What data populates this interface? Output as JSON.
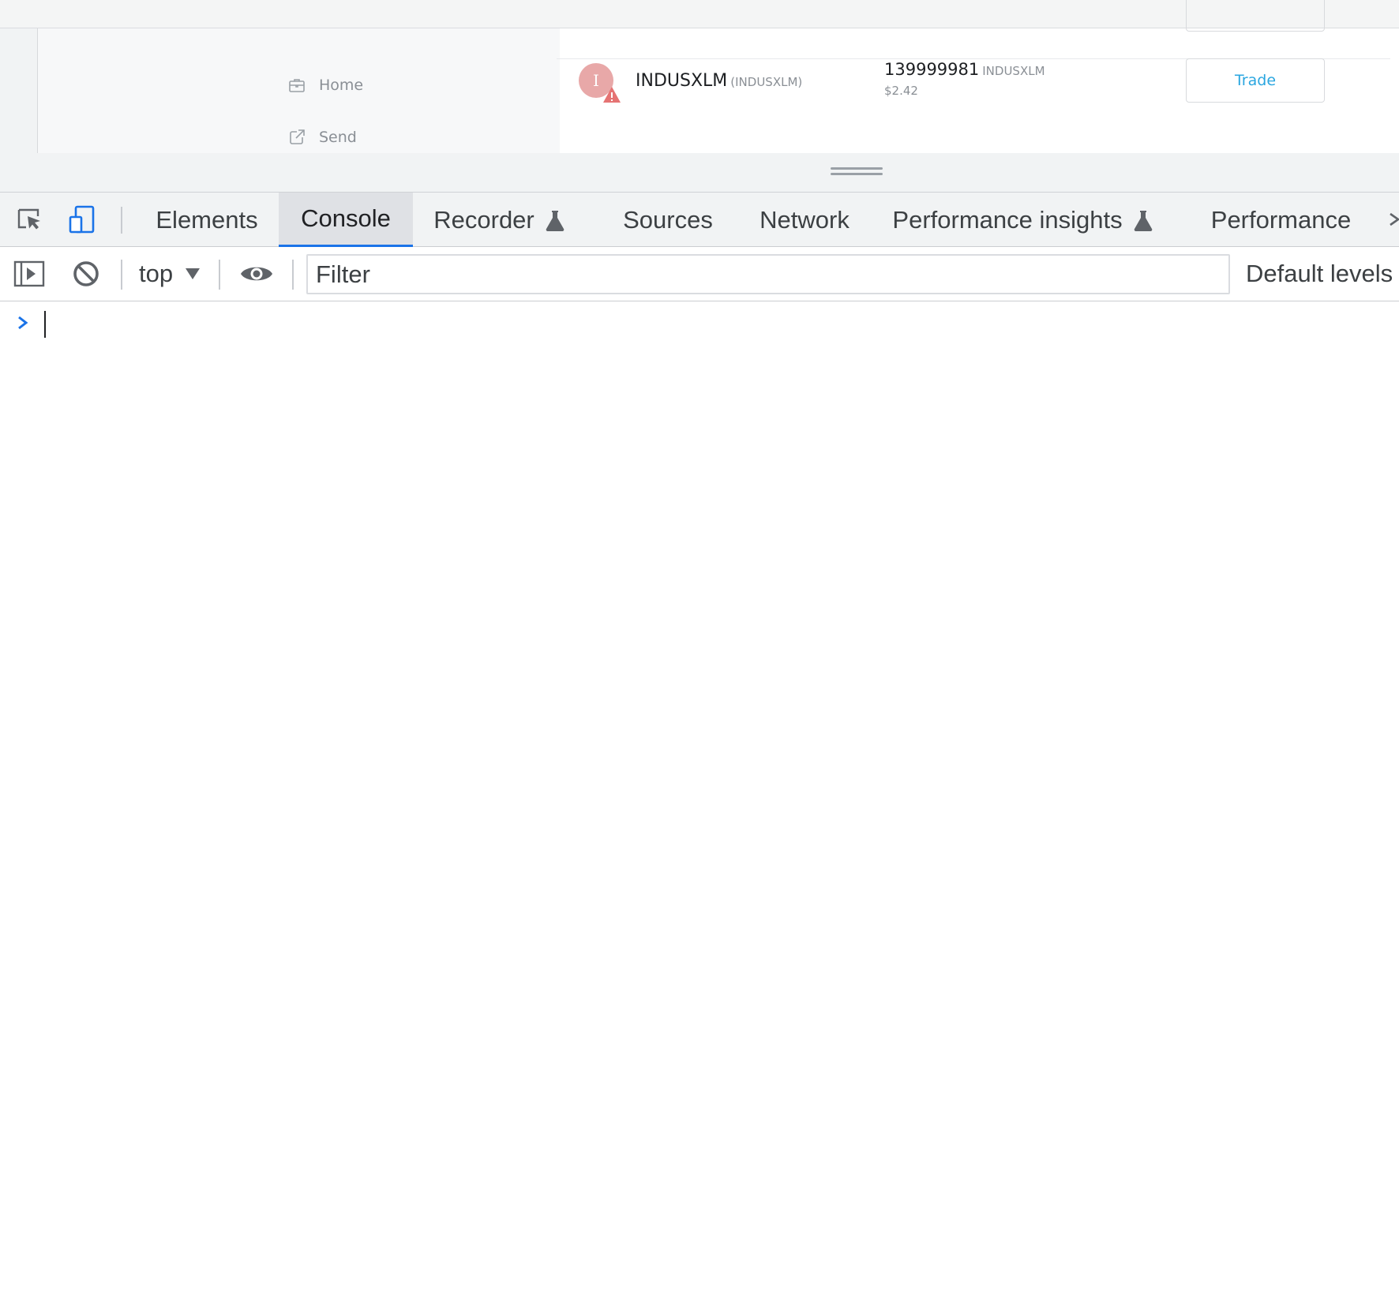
{
  "page": {
    "sidebar": {
      "items": [
        {
          "label": "Home",
          "icon": "briefcase-icon"
        },
        {
          "label": "Send",
          "icon": "external-link-icon"
        }
      ]
    },
    "asset": {
      "avatar_letter": "I",
      "name": "INDUSXLM",
      "code": "(INDUSXLM)",
      "balance": "139999981",
      "balance_unit": "INDUSXLM",
      "usd_value": "$2.42",
      "trade_label": "Trade",
      "warning_color": "#e57373",
      "trade_color": "#2aa6e0"
    }
  },
  "devtools": {
    "tabs": [
      {
        "label": "Elements",
        "active": false
      },
      {
        "label": "Console",
        "active": true
      },
      {
        "label": "Recorder",
        "active": false,
        "experimental": true
      },
      {
        "label": "Sources",
        "active": false
      },
      {
        "label": "Network",
        "active": false
      },
      {
        "label": "Performance insights",
        "active": false,
        "experimental": true
      },
      {
        "label": "Performance",
        "active": false
      }
    ],
    "toolbar": {
      "context": "top",
      "filter_placeholder": "Filter",
      "levels_label": "Default levels"
    },
    "accent_color": "#1a73e8"
  }
}
